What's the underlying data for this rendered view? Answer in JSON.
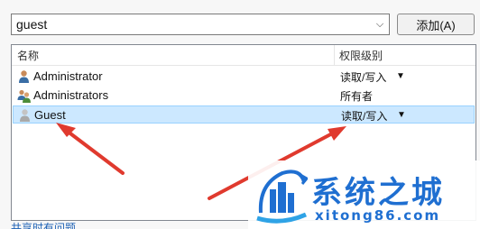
{
  "top": {
    "input_value": "guest",
    "add_button": "添加(A)"
  },
  "list": {
    "columns": {
      "name": "名称",
      "permission": "权限级别"
    },
    "rows": [
      {
        "name": "Administrator",
        "permission": "读取/写入",
        "has_dropdown": true,
        "icon": "user-icon"
      },
      {
        "name": "Administrators",
        "permission": "所有者",
        "has_dropdown": false,
        "icon": "user-group-icon"
      },
      {
        "name": "Guest",
        "permission": "读取/写入",
        "has_dropdown": true,
        "icon": "guest-user-icon",
        "selected": true
      }
    ]
  },
  "bottom_link": "共享时有问题",
  "watermark": {
    "title": "系统之城",
    "url": "xitong86.com"
  },
  "colors": {
    "selection": "#cce8ff",
    "annotation_arrow": "#e03a2e",
    "watermark_blue": "#1f6fd1"
  }
}
